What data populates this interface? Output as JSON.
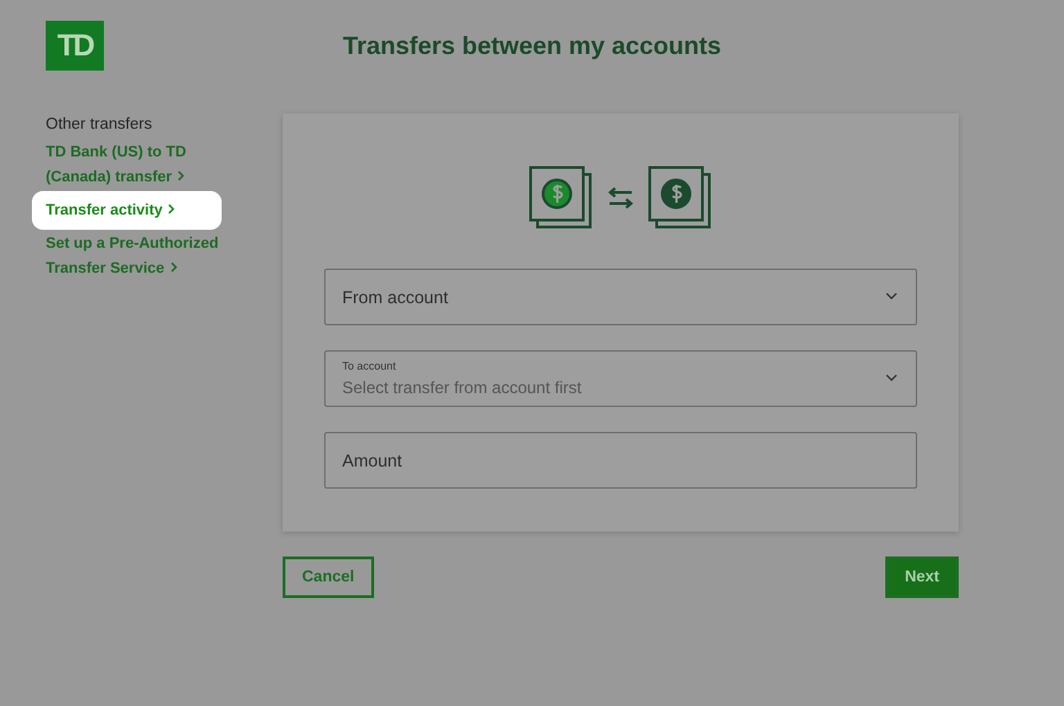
{
  "logo": {
    "text": "TD"
  },
  "title": "Transfers between my accounts",
  "sidebar": {
    "heading": "Other transfers",
    "links": [
      {
        "label": "TD Bank (US) to TD (Canada) transfer",
        "selected": false
      },
      {
        "label": "Transfer activity",
        "selected": true
      },
      {
        "label": "Set up a Pre-Authorized Transfer Service",
        "selected": false
      }
    ]
  },
  "form": {
    "fields": [
      {
        "kind": "select",
        "placeholder": "From account"
      },
      {
        "kind": "select",
        "label": "To account",
        "placeholder": "Select transfer from account first"
      },
      {
        "kind": "input",
        "placeholder": "Amount"
      }
    ]
  },
  "buttons": [
    {
      "label": "Cancel",
      "kind": "secondary"
    },
    {
      "label": "Next",
      "kind": "primary"
    }
  ]
}
